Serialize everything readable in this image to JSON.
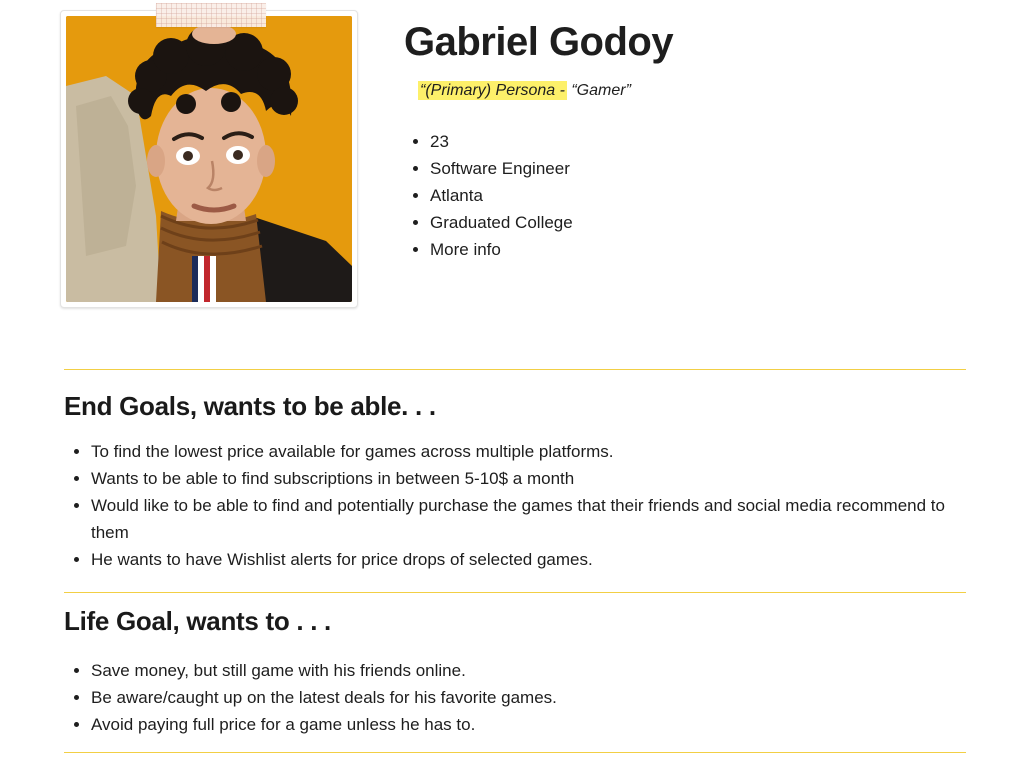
{
  "profile": {
    "name": "Gabriel Godoy",
    "persona_highlight": "“(Primary) Persona -",
    "persona_rest": " “Gamer”",
    "facts": [
      "23",
      "Software Engineer",
      "Atlanta",
      "Graduated College",
      "More info"
    ]
  },
  "end_goals": {
    "title": "End Goals, wants to be able. . .",
    "items": [
      "To find the lowest price available for games across multiple platforms.",
      "Wants to be able to find subscriptions in between 5-10$ a month",
      "Would like to be able to find and potentially purchase the games that their friends and social media recommend to them",
      "He wants to have Wishlist alerts for price drops of selected games."
    ]
  },
  "life_goal": {
    "title": "Life Goal, wants to . . .",
    "items": [
      "Save money, but still game with his friends online.",
      "Be aware/caught up on the latest deals for his favorite games.",
      "Avoid paying full price for a game unless he has to."
    ]
  },
  "colors": {
    "highlight": "#fdf06a",
    "divider": "#f2cf45",
    "photo_background": "#e59a0d"
  }
}
